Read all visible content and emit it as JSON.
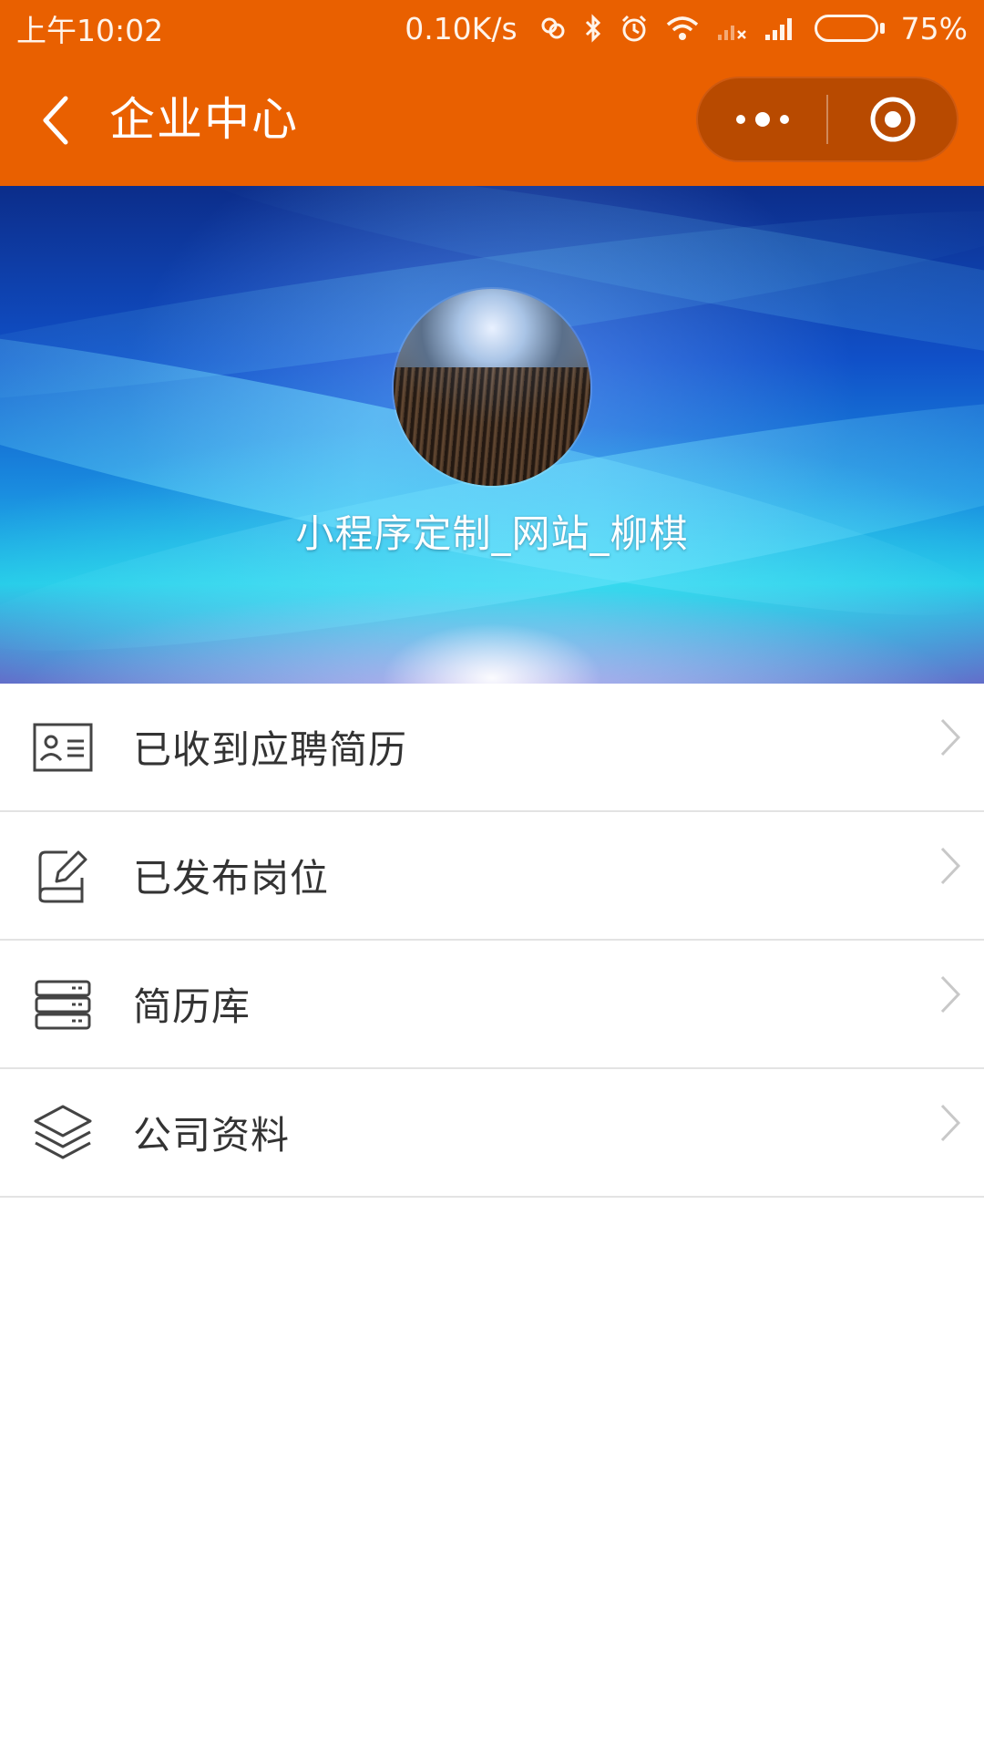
{
  "status_bar": {
    "time": "上午10:02",
    "net_speed": "0.10K/s",
    "battery_percent": "75%",
    "battery_level": 0.75
  },
  "nav": {
    "title": "企业中心"
  },
  "profile": {
    "name": "小程序定制_网站_柳棋"
  },
  "menu": {
    "items": [
      {
        "label": "已收到应聘简历",
        "icon": "resume-card-icon"
      },
      {
        "label": "已发布岗位",
        "icon": "edit-post-icon"
      },
      {
        "label": "简历库",
        "icon": "database-icon"
      },
      {
        "label": "公司资料",
        "icon": "layers-icon"
      }
    ]
  },
  "colors": {
    "header_bg": "#e96000",
    "capsule_bg": "#b84a00",
    "menu_text": "#333333",
    "divider": "#e3e3e3"
  }
}
